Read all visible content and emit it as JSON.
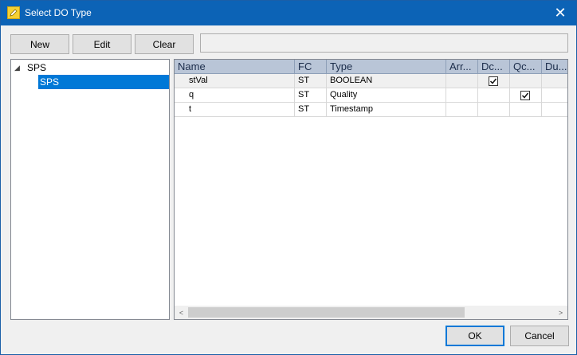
{
  "window": {
    "title": "Select DO Type",
    "close_glyph": "✕"
  },
  "toolbar": {
    "new_label": "New",
    "edit_label": "Edit",
    "clear_label": "Clear",
    "status_text": ""
  },
  "tree": {
    "root_label": "SPS",
    "child_label": "SPS",
    "expand_glyph": "◢"
  },
  "grid": {
    "columns": [
      "Name",
      "FC",
      "Type",
      "Arr...",
      "Dc...",
      "Qc...",
      "Du..."
    ],
    "rows": [
      {
        "name": "stVal",
        "fc": "ST",
        "type": "BOOLEAN",
        "arr": "",
        "dchg": true,
        "qchg": false,
        "dupd": ""
      },
      {
        "name": "q",
        "fc": "ST",
        "type": "Quality",
        "arr": "",
        "dchg": false,
        "qchg": true,
        "dupd": ""
      },
      {
        "name": "t",
        "fc": "ST",
        "type": "Timestamp",
        "arr": "",
        "dchg": false,
        "qchg": false,
        "dupd": ""
      }
    ]
  },
  "scrollbar": {
    "left_arrow": "<",
    "right_arrow": ">"
  },
  "footer": {
    "ok_label": "OK",
    "cancel_label": "Cancel"
  },
  "icons": {
    "app": "pencil-icon",
    "close": "close-icon"
  },
  "colors": {
    "titlebar": "#0c63b6",
    "selection": "#0078d7",
    "header": "#b9c5d7"
  }
}
